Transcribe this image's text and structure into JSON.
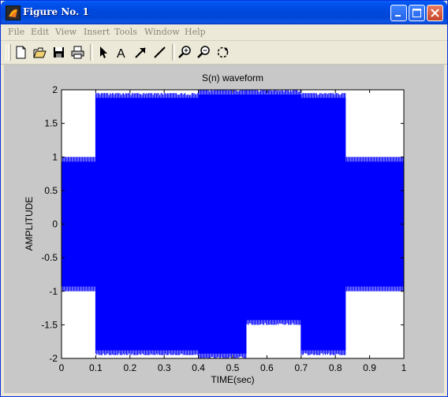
{
  "window": {
    "title": "Figure No. 1",
    "icon": "matlab-figure-icon",
    "minimize_icon": "minimize-icon",
    "maximize_icon": "maximize-icon",
    "close_icon": "close-icon"
  },
  "menu": [
    "File",
    "Edit",
    "View",
    "Insert",
    "Tools",
    "Window",
    "Help"
  ],
  "toolbar": {
    "buttons": [
      "new-icon",
      "open-icon",
      "save-icon",
      "print-icon",
      "arrow-select-icon",
      "text-icon",
      "arrow-icon",
      "line-icon",
      "zoom-in-icon",
      "zoom-out-icon",
      "rotate-3d-icon"
    ]
  },
  "colors": {
    "signal": "#0000ff",
    "plot_background": "#ffffff",
    "figure_background": "#c8c8c8"
  },
  "chart_data": {
    "type": "line",
    "title": "S(n) waveform",
    "xlabel": "TIME(sec)",
    "ylabel": "AMPLITUDE",
    "xlim": [
      0,
      1
    ],
    "ylim": [
      -2,
      2
    ],
    "xticks": [
      "0",
      "0.1",
      "0.2",
      "0.3",
      "0.4",
      "0.5",
      "0.6",
      "0.7",
      "0.8",
      "0.9",
      "1"
    ],
    "yticks": [
      "2",
      "1.5",
      "1",
      "0.5",
      "0",
      "-0.5",
      "-1",
      "-1.5",
      "-2"
    ],
    "grid": false,
    "series": [
      {
        "color": "#0000ff",
        "envelope": [
          {
            "x": [
              0,
              0.1
            ],
            "ymin": -1,
            "ymax": 1
          },
          {
            "x": [
              0.1,
              0.4
            ],
            "ymin": -1.95,
            "ymax": 1.95
          },
          {
            "x": [
              0.4,
              0.54
            ],
            "ymin": -2,
            "ymax": 2
          },
          {
            "x": [
              0.54,
              0.7
            ],
            "ymin": -1.5,
            "ymax": 2
          },
          {
            "x": [
              0.7,
              0.83
            ],
            "ymin": -1.95,
            "ymax": 1.95
          },
          {
            "x": [
              0.83,
              1
            ],
            "ymin": -1,
            "ymax": 1
          }
        ]
      }
    ]
  }
}
